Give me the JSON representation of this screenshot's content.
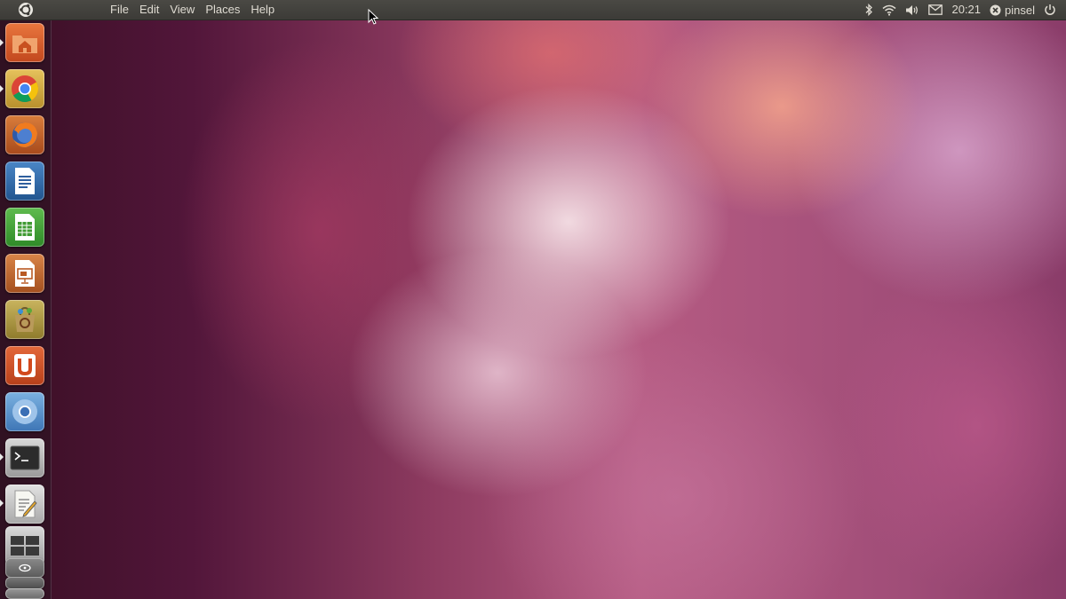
{
  "menubar": {
    "items": [
      "File",
      "Edit",
      "View",
      "Places",
      "Help"
    ]
  },
  "tray": {
    "clock": "20:21",
    "user": "pinsel"
  },
  "launcher": {
    "items": [
      {
        "name": "home-folder",
        "running": true
      },
      {
        "name": "chrome",
        "running": true
      },
      {
        "name": "firefox",
        "running": false
      },
      {
        "name": "libreoffice-writer",
        "running": false
      },
      {
        "name": "libreoffice-calc",
        "running": false
      },
      {
        "name": "libreoffice-impress",
        "running": false
      },
      {
        "name": "software-center",
        "running": false
      },
      {
        "name": "ubuntu-one",
        "running": false
      },
      {
        "name": "chromium",
        "running": false
      },
      {
        "name": "terminal",
        "running": true
      },
      {
        "name": "text-editor",
        "running": true
      },
      {
        "name": "workspace-switcher",
        "running": false
      },
      {
        "name": "trash",
        "running": false
      }
    ]
  },
  "colors": {
    "panel": "#3c3b37",
    "panel_text": "#dfdbd2",
    "accent": "#dd4814"
  }
}
